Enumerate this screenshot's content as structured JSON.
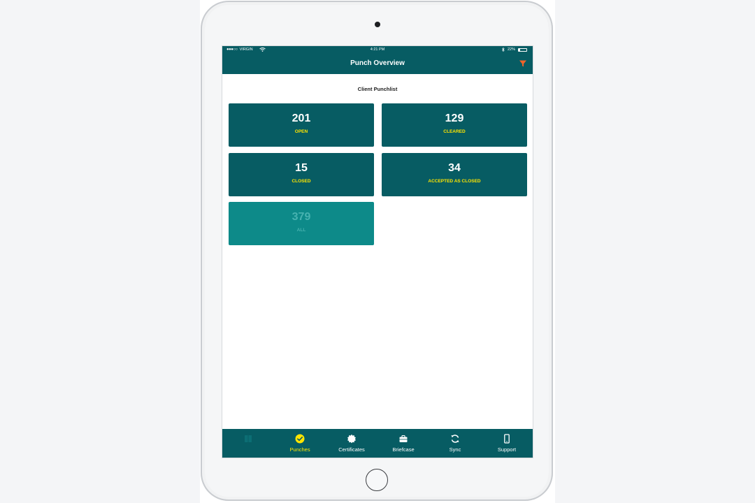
{
  "status_bar": {
    "carrier": "VIRGIN",
    "signal_dots": "●●●○○",
    "time": "4:21 PM",
    "battery_percent": "22%",
    "battery_level": 0.22
  },
  "nav": {
    "title": "Punch Overview",
    "filter_icon": "filter-icon"
  },
  "section": {
    "title": "Client Punchlist"
  },
  "cards": [
    {
      "count": "201",
      "label": "OPEN"
    },
    {
      "count": "129",
      "label": "CLEARED"
    },
    {
      "count": "15",
      "label": "CLOSED"
    },
    {
      "count": "34",
      "label": "ACCEPTED AS CLOSED"
    },
    {
      "count": "379",
      "label": "ALL"
    }
  ],
  "tabs": [
    {
      "label": "",
      "icon": "book-icon"
    },
    {
      "label": "Punches",
      "icon": "check-circle-icon"
    },
    {
      "label": "Certificates",
      "icon": "certificate-icon"
    },
    {
      "label": "Briefcase",
      "icon": "briefcase-icon"
    },
    {
      "label": "Sync",
      "icon": "sync-icon"
    },
    {
      "label": "Support",
      "icon": "phone-icon"
    }
  ],
  "colors": {
    "primary": "#075c63",
    "accent_yellow": "#ffe500",
    "all_card": "#0d8a89",
    "filter_orange": "#f0642a"
  }
}
